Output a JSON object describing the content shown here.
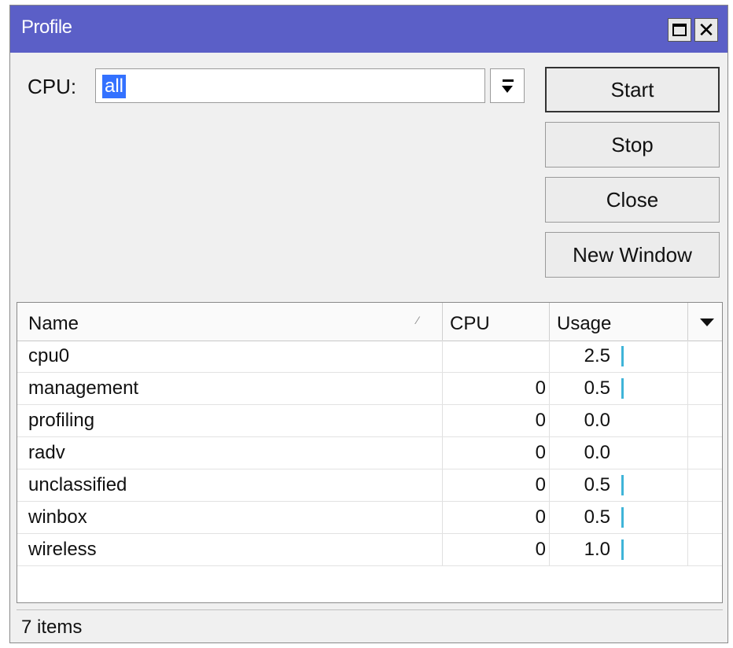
{
  "window": {
    "title": "Profile"
  },
  "cpu": {
    "label": "CPU:",
    "value": "all"
  },
  "buttons": {
    "start": "Start",
    "stop": "Stop",
    "close": "Close",
    "new_window": "New Window"
  },
  "table": {
    "columns": [
      "Name",
      "CPU",
      "Usage"
    ],
    "rows": [
      {
        "name": "cpu0",
        "cpu": "",
        "usage": "2.5",
        "usage_level": 2.5
      },
      {
        "name": "management",
        "cpu": "0",
        "usage": "0.5",
        "usage_level": 0.5
      },
      {
        "name": "profiling",
        "cpu": "0",
        "usage": "0.0",
        "usage_level": 0.0
      },
      {
        "name": "radv",
        "cpu": "0",
        "usage": "0.0",
        "usage_level": 0.0
      },
      {
        "name": "unclassified",
        "cpu": "0",
        "usage": "0.5",
        "usage_level": 0.5
      },
      {
        "name": "winbox",
        "cpu": "0",
        "usage": "0.5",
        "usage_level": 0.5
      },
      {
        "name": "wireless",
        "cpu": "0",
        "usage": "1.0",
        "usage_level": 1.0
      }
    ]
  },
  "status": {
    "items_count": "7 items"
  },
  "colors": {
    "titlebar": "#5b5fc7",
    "selection": "#3371ff",
    "usage_bar": "#3fb4d8"
  }
}
